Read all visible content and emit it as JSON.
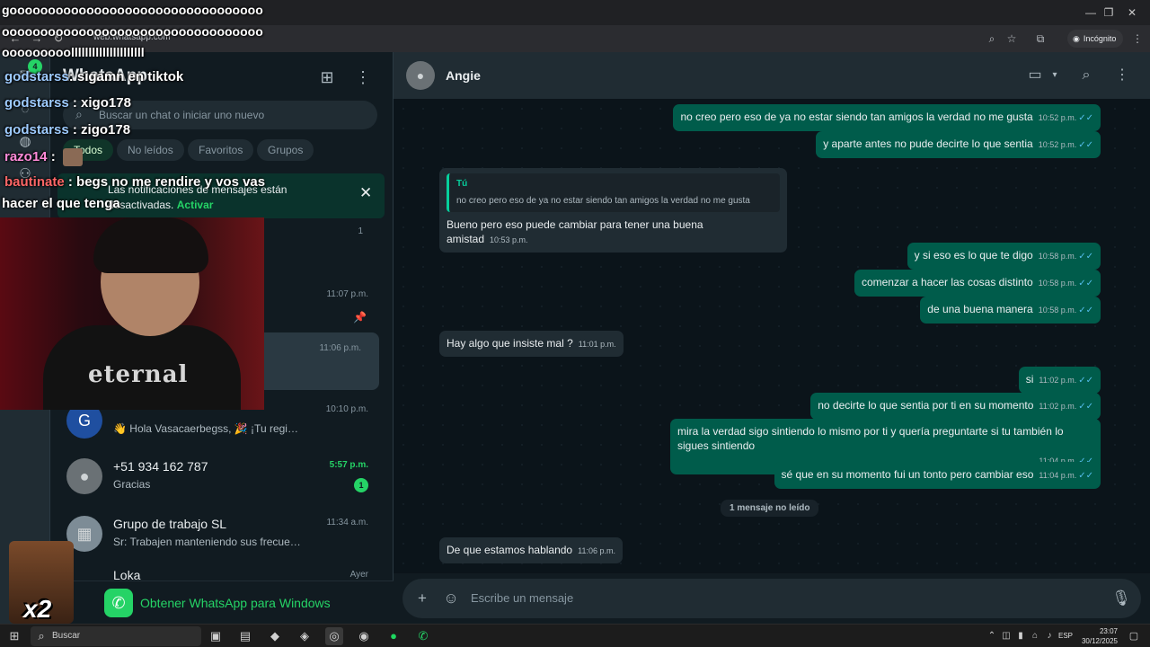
{
  "browser": {
    "url": "web.whatsapp.com",
    "incognito_label": "Incógnito"
  },
  "rail": {
    "chats_badge": "4"
  },
  "sidebar": {
    "title": "WhatsApp",
    "search_placeholder": "Buscar un chat o iniciar uno nuevo",
    "filters": [
      "Todos",
      "No leídos",
      "Favoritos",
      "Grupos"
    ],
    "notice": {
      "text": "Las notificaciones de mensajes están desactivadas.",
      "link": "Activar"
    },
    "chats": [
      {
        "name": "",
        "preview": "",
        "time": "",
        "unread": "1"
      },
      {
        "name": "",
        "preview": "",
        "time": "11:07 p.m.",
        "pinned": true
      },
      {
        "name": "",
        "preview": "",
        "time": "11:06 p.m.",
        "selected": true
      },
      {
        "name": "",
        "preview": "👋 Hola Vasacaerbegss, 🎉 ¡Tu registro en la carrer…",
        "time": "10:10 p.m."
      },
      {
        "name": "+51 934 162 787",
        "preview": "Gracias",
        "time": "5:57 p.m.",
        "unread": "1"
      },
      {
        "name": "Grupo de trabajo SL",
        "preview": "Sr: Trabajen manteniendo sus frecuencia por el trafi…",
        "time": "11:34 a.m."
      },
      {
        "name": "Loka",
        "preview": "",
        "time": "Ayer"
      }
    ],
    "get_app": "Obtener WhatsApp para Windows"
  },
  "chat": {
    "contact": "Angie",
    "messages": [
      {
        "dir": "out",
        "text": "no creo pero eso de ya no estar siendo tan amigos la verdad no me gusta",
        "time": "10:52 p.m."
      },
      {
        "dir": "out",
        "text": "y aparte antes no pude decirte lo que sentia",
        "time": "10:52 p.m."
      },
      {
        "dir": "in",
        "quote_name": "Tú",
        "quote_text": "no creo pero eso de ya no estar siendo tan amigos la verdad no me gusta",
        "text": "Bueno pero eso puede cambiar para tener una buena amistad",
        "time": "10:53 p.m."
      },
      {
        "dir": "out",
        "text": "y si eso es lo que te digo",
        "time": "10:58 p.m."
      },
      {
        "dir": "out",
        "text": "comenzar a hacer las cosas distinto",
        "time": "10:58 p.m."
      },
      {
        "dir": "out",
        "text": "de una buena manera",
        "time": "10:58 p.m."
      },
      {
        "dir": "in",
        "text": "Hay algo que insiste mal ?",
        "time": "11:01 p.m."
      },
      {
        "dir": "out",
        "text": "si",
        "time": "11:02 p.m."
      },
      {
        "dir": "out",
        "text": "no decirte lo que sentia por ti en su momento",
        "time": "11:02 p.m."
      },
      {
        "dir": "out",
        "text": "mira la verdad sigo sintiendo lo mismo por ti y quería preguntarte si tu también lo sigues sintiendo",
        "time": "11:04 p.m."
      },
      {
        "dir": "out",
        "text": "sé que en su momento fui un tonto pero cambiar eso",
        "time": "11:04 p.m."
      },
      {
        "dir": "in",
        "text": "De que estamos hablando",
        "time": "11:06 p.m."
      }
    ],
    "unread_divider": "1 mensaje no leído",
    "composer_placeholder": "Escribe un mensaje"
  },
  "overlay": {
    "spam_lines": [
      "gooooooooooooooooooooooooooooooooo",
      "oooooooooooooooooooooooooooooooooo",
      "ooooooooolllllllllllllllllllll"
    ],
    "chat": [
      {
        "user": "godstarss",
        "sep": ":",
        "msg": "sigamn en tiktok"
      },
      {
        "user": "godstarss",
        "sep": ":",
        "msg": "xigo178"
      },
      {
        "user": "godstarss",
        "sep": ":",
        "msg": "zigo178"
      },
      {
        "user": "razo14",
        "sep": ":",
        "msg": ""
      },
      {
        "user": "bautinate",
        "sep": ":",
        "msg": "begs no me rendire y vos vas"
      }
    ],
    "chat_continuation": "hacer el que tenga",
    "shirt_text": "eternal",
    "emote_label": "x2"
  },
  "taskbar": {
    "search_label": "Buscar",
    "lang": "ESP",
    "time": "23:07",
    "date": "30/12/2025"
  }
}
